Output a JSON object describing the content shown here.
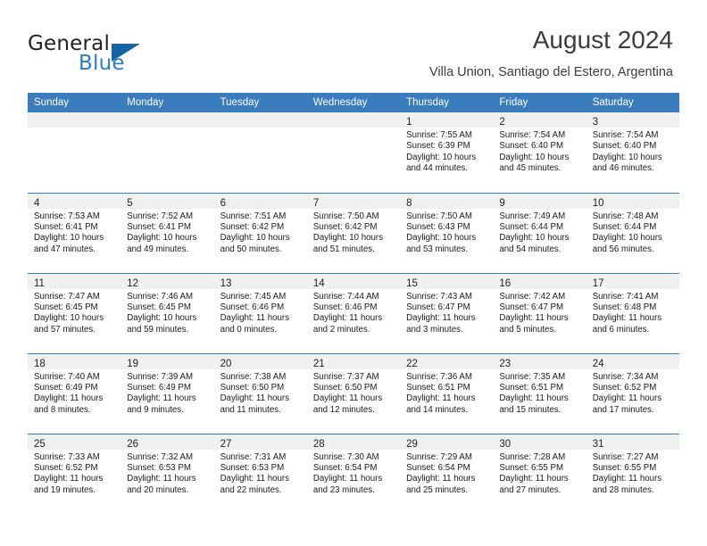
{
  "brand": {
    "word_one": "General",
    "word_two": "Blue",
    "triangle_icon": "triangle-icon",
    "accent_color": "#2b7cc4",
    "triangle_color": "#1464a5"
  },
  "header": {
    "title": "August 2024",
    "subtitle": "Villa Union, Santiago del Estero, Argentina"
  },
  "calendar": {
    "header_background": "#3a7cbe",
    "daynum_background": "#f0f0f0",
    "weekday_headers": [
      "Sunday",
      "Monday",
      "Tuesday",
      "Wednesday",
      "Thursday",
      "Friday",
      "Saturday"
    ],
    "weeks": [
      [
        {
          "day": "",
          "lines": []
        },
        {
          "day": "",
          "lines": []
        },
        {
          "day": "",
          "lines": []
        },
        {
          "day": "",
          "lines": []
        },
        {
          "day": "1",
          "lines": [
            "Sunrise: 7:55 AM",
            "Sunset: 6:39 PM",
            "Daylight: 10 hours",
            "and 44 minutes."
          ]
        },
        {
          "day": "2",
          "lines": [
            "Sunrise: 7:54 AM",
            "Sunset: 6:40 PM",
            "Daylight: 10 hours",
            "and 45 minutes."
          ]
        },
        {
          "day": "3",
          "lines": [
            "Sunrise: 7:54 AM",
            "Sunset: 6:40 PM",
            "Daylight: 10 hours",
            "and 46 minutes."
          ]
        }
      ],
      [
        {
          "day": "4",
          "lines": [
            "Sunrise: 7:53 AM",
            "Sunset: 6:41 PM",
            "Daylight: 10 hours",
            "and 47 minutes."
          ]
        },
        {
          "day": "5",
          "lines": [
            "Sunrise: 7:52 AM",
            "Sunset: 6:41 PM",
            "Daylight: 10 hours",
            "and 49 minutes."
          ]
        },
        {
          "day": "6",
          "lines": [
            "Sunrise: 7:51 AM",
            "Sunset: 6:42 PM",
            "Daylight: 10 hours",
            "and 50 minutes."
          ]
        },
        {
          "day": "7",
          "lines": [
            "Sunrise: 7:50 AM",
            "Sunset: 6:42 PM",
            "Daylight: 10 hours",
            "and 51 minutes."
          ]
        },
        {
          "day": "8",
          "lines": [
            "Sunrise: 7:50 AM",
            "Sunset: 6:43 PM",
            "Daylight: 10 hours",
            "and 53 minutes."
          ]
        },
        {
          "day": "9",
          "lines": [
            "Sunrise: 7:49 AM",
            "Sunset: 6:44 PM",
            "Daylight: 10 hours",
            "and 54 minutes."
          ]
        },
        {
          "day": "10",
          "lines": [
            "Sunrise: 7:48 AM",
            "Sunset: 6:44 PM",
            "Daylight: 10 hours",
            "and 56 minutes."
          ]
        }
      ],
      [
        {
          "day": "11",
          "lines": [
            "Sunrise: 7:47 AM",
            "Sunset: 6:45 PM",
            "Daylight: 10 hours",
            "and 57 minutes."
          ]
        },
        {
          "day": "12",
          "lines": [
            "Sunrise: 7:46 AM",
            "Sunset: 6:45 PM",
            "Daylight: 10 hours",
            "and 59 minutes."
          ]
        },
        {
          "day": "13",
          "lines": [
            "Sunrise: 7:45 AM",
            "Sunset: 6:46 PM",
            "Daylight: 11 hours",
            "and 0 minutes."
          ]
        },
        {
          "day": "14",
          "lines": [
            "Sunrise: 7:44 AM",
            "Sunset: 6:46 PM",
            "Daylight: 11 hours",
            "and 2 minutes."
          ]
        },
        {
          "day": "15",
          "lines": [
            "Sunrise: 7:43 AM",
            "Sunset: 6:47 PM",
            "Daylight: 11 hours",
            "and 3 minutes."
          ]
        },
        {
          "day": "16",
          "lines": [
            "Sunrise: 7:42 AM",
            "Sunset: 6:47 PM",
            "Daylight: 11 hours",
            "and 5 minutes."
          ]
        },
        {
          "day": "17",
          "lines": [
            "Sunrise: 7:41 AM",
            "Sunset: 6:48 PM",
            "Daylight: 11 hours",
            "and 6 minutes."
          ]
        }
      ],
      [
        {
          "day": "18",
          "lines": [
            "Sunrise: 7:40 AM",
            "Sunset: 6:49 PM",
            "Daylight: 11 hours",
            "and 8 minutes."
          ]
        },
        {
          "day": "19",
          "lines": [
            "Sunrise: 7:39 AM",
            "Sunset: 6:49 PM",
            "Daylight: 11 hours",
            "and 9 minutes."
          ]
        },
        {
          "day": "20",
          "lines": [
            "Sunrise: 7:38 AM",
            "Sunset: 6:50 PM",
            "Daylight: 11 hours",
            "and 11 minutes."
          ]
        },
        {
          "day": "21",
          "lines": [
            "Sunrise: 7:37 AM",
            "Sunset: 6:50 PM",
            "Daylight: 11 hours",
            "and 12 minutes."
          ]
        },
        {
          "day": "22",
          "lines": [
            "Sunrise: 7:36 AM",
            "Sunset: 6:51 PM",
            "Daylight: 11 hours",
            "and 14 minutes."
          ]
        },
        {
          "day": "23",
          "lines": [
            "Sunrise: 7:35 AM",
            "Sunset: 6:51 PM",
            "Daylight: 11 hours",
            "and 15 minutes."
          ]
        },
        {
          "day": "24",
          "lines": [
            "Sunrise: 7:34 AM",
            "Sunset: 6:52 PM",
            "Daylight: 11 hours",
            "and 17 minutes."
          ]
        }
      ],
      [
        {
          "day": "25",
          "lines": [
            "Sunrise: 7:33 AM",
            "Sunset: 6:52 PM",
            "Daylight: 11 hours",
            "and 19 minutes."
          ]
        },
        {
          "day": "26",
          "lines": [
            "Sunrise: 7:32 AM",
            "Sunset: 6:53 PM",
            "Daylight: 11 hours",
            "and 20 minutes."
          ]
        },
        {
          "day": "27",
          "lines": [
            "Sunrise: 7:31 AM",
            "Sunset: 6:53 PM",
            "Daylight: 11 hours",
            "and 22 minutes."
          ]
        },
        {
          "day": "28",
          "lines": [
            "Sunrise: 7:30 AM",
            "Sunset: 6:54 PM",
            "Daylight: 11 hours",
            "and 23 minutes."
          ]
        },
        {
          "day": "29",
          "lines": [
            "Sunrise: 7:29 AM",
            "Sunset: 6:54 PM",
            "Daylight: 11 hours",
            "and 25 minutes."
          ]
        },
        {
          "day": "30",
          "lines": [
            "Sunrise: 7:28 AM",
            "Sunset: 6:55 PM",
            "Daylight: 11 hours",
            "and 27 minutes."
          ]
        },
        {
          "day": "31",
          "lines": [
            "Sunrise: 7:27 AM",
            "Sunset: 6:55 PM",
            "Daylight: 11 hours",
            "and 28 minutes."
          ]
        }
      ]
    ]
  }
}
